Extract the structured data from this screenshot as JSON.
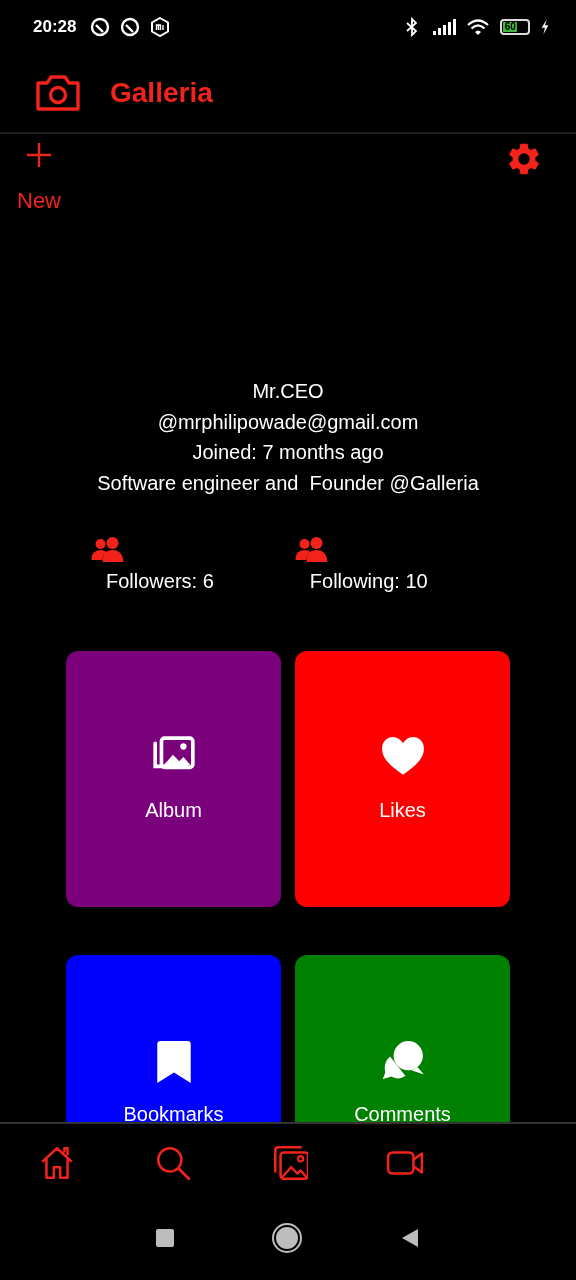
{
  "status_bar": {
    "time": "20:28",
    "battery": "60"
  },
  "app_bar": {
    "title": "Galleria"
  },
  "toolbar": {
    "new_label": "New"
  },
  "profile": {
    "name": "Mr.CEO",
    "email": "@mrphilipowade@gmail.com",
    "joined": "Joined: 7 months ago",
    "bio": "Software engineer and  Founder @Galleria"
  },
  "stats": [
    {
      "label": "Followers: 6"
    },
    {
      "label": "Following: 10"
    }
  ],
  "tiles": [
    {
      "kind": "album",
      "label": "Album",
      "color": "#7b007b"
    },
    {
      "kind": "likes",
      "label": "Likes",
      "color": "#ff0000"
    },
    {
      "kind": "bookmarks",
      "label": "Bookmarks",
      "color": "#0000ff"
    },
    {
      "kind": "comments",
      "label": "Comments",
      "color": "#008000"
    }
  ],
  "bottom_nav": [
    {
      "kind": "home"
    },
    {
      "kind": "search"
    },
    {
      "kind": "gallery"
    },
    {
      "kind": "video"
    }
  ]
}
